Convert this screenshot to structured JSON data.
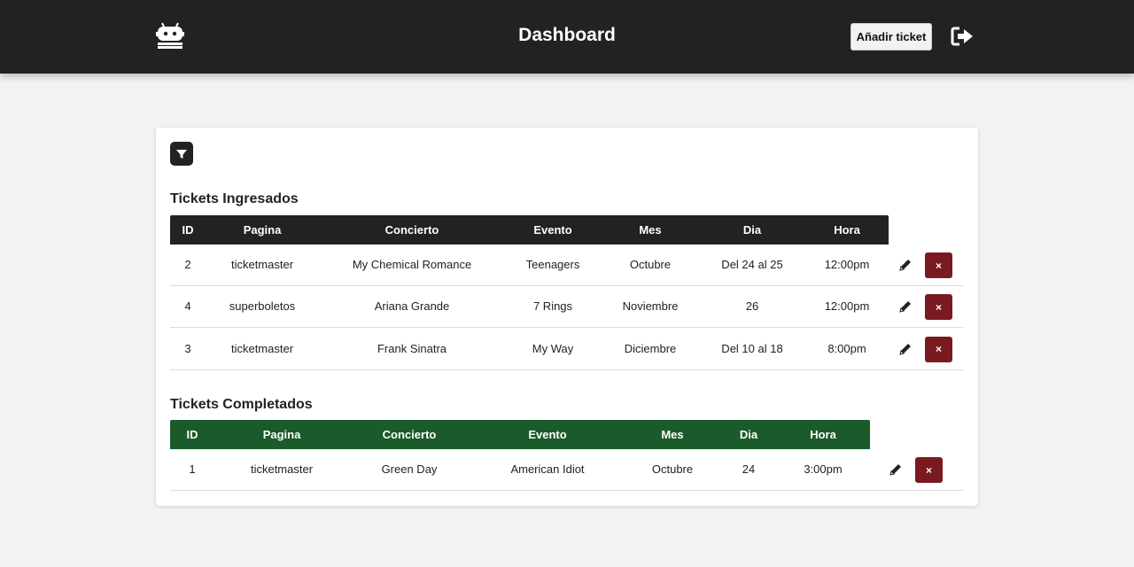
{
  "header": {
    "title": "Dashboard",
    "add_ticket_label": "Añadir ticket",
    "logo_icon": "robot-icon",
    "logout_icon": "sign-out-icon",
    "background": "#222222"
  },
  "filter": {
    "icon": "filter-icon"
  },
  "ingresados": {
    "title": "Tickets Ingresados",
    "header_color": "#222222",
    "columns": [
      "ID",
      "Pagina",
      "Concierto",
      "Evento",
      "Mes",
      "Dia",
      "Hora"
    ],
    "rows": [
      [
        "2",
        "ticketmaster",
        "My Chemical Romance",
        "Teenagers",
        "Octubre",
        "Del 24 al 25",
        "12:00pm"
      ],
      [
        "4",
        "superboletos",
        "Ariana Grande",
        "7 Rings",
        "Noviembre",
        "26",
        "12:00pm"
      ],
      [
        "3",
        "ticketmaster",
        "Frank Sinatra",
        "My Way",
        "Diciembre",
        "Del 10 al 18",
        "8:00pm"
      ]
    ]
  },
  "completados": {
    "title": "Tickets Completados",
    "header_color": "#1b5a2a",
    "columns": [
      "ID",
      "Pagina",
      "Concierto",
      "Evento",
      "Mes",
      "Dia",
      "Hora"
    ],
    "rows": [
      [
        "1",
        "ticketmaster",
        "Green Day",
        "American Idiot",
        "Octubre",
        "24",
        "3:00pm"
      ]
    ]
  },
  "actions": {
    "edit_icon": "pencil-icon",
    "delete_icon": "close-icon",
    "delete_label": "×",
    "delete_color": "#7a1a20"
  }
}
